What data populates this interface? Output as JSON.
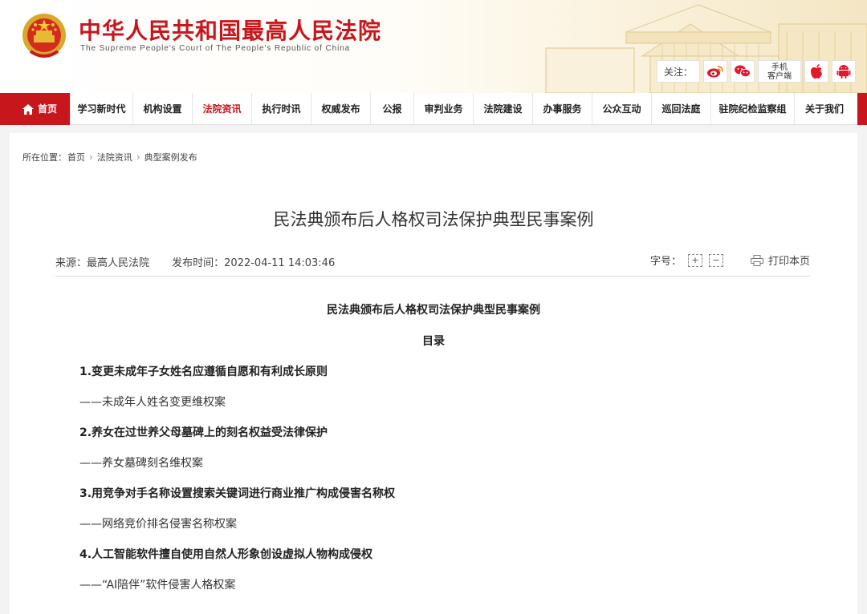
{
  "site": {
    "title": "中华人民共和国最高人民法院",
    "subtitle": "The Supreme People's Court of The People's Republic of China",
    "follow_label": "关注：",
    "mobile_client_line1": "手机",
    "mobile_client_line2": "客户端"
  },
  "nav": {
    "home": "首页",
    "items": [
      "学习新时代",
      "机构设置",
      "法院资讯",
      "执行时讯",
      "权威发布",
      "公报",
      "审判业务",
      "法院建设",
      "办事服务",
      "公众互动",
      "巡回法庭",
      "驻院纪检监察组",
      "关于我们"
    ],
    "active_index": 2
  },
  "breadcrumb": {
    "prefix": "所在位置：",
    "items": [
      "首页",
      "法院资讯",
      "典型案例发布"
    ]
  },
  "article": {
    "title": "民法典颁布后人格权司法保护典型民事案例",
    "source": "来源：最高人民法院",
    "publish_time": "发布时间：2022-04-11 14:03:46",
    "font_size_label": "字号：",
    "increase": "+",
    "decrease": "−",
    "print_label": "打印本页",
    "body_title": "民法典颁布后人格权司法保护典型民事案例",
    "toc_label": "目录",
    "cases": [
      {
        "title": "1.变更未成年子女姓名应遵循自愿和有利成长原则",
        "sub": "——未成年人姓名变更维权案"
      },
      {
        "title": "2.养女在过世养父母墓碑上的刻名权益受法律保护",
        "sub": "——养女墓碑刻名维权案"
      },
      {
        "title": "3.用竞争对手名称设置搜索关键词进行商业推广构成侵害名称权",
        "sub": "——网络竞价排名侵害名称权案"
      },
      {
        "title": "4.人工智能软件擅自使用自然人形象创设虚拟人物构成侵权",
        "sub": "——“AI陪伴”软件侵害人格权案"
      }
    ]
  },
  "colors": {
    "brand_red": "#c8161d",
    "weibo_red": "#e6162d"
  },
  "icons": [
    "national-emblem-icon",
    "weibo-icon",
    "wechat-icon",
    "apple-icon",
    "android-icon",
    "home-icon",
    "printer-icon"
  ]
}
